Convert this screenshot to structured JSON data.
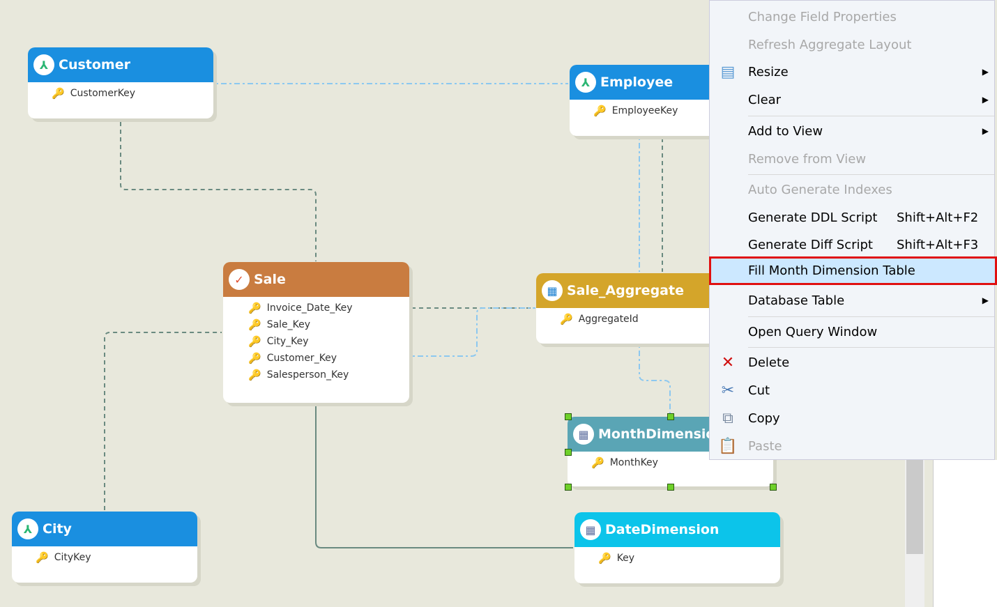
{
  "tables": {
    "customer": {
      "title": "Customer",
      "fields": [
        "CustomerKey"
      ],
      "color": "#1a8fe0"
    },
    "employee": {
      "title": "Employee",
      "fields": [
        "EmployeeKey"
      ],
      "color": "#1a8fe0"
    },
    "sale": {
      "title": "Sale",
      "fields": [
        "Invoice_Date_Key",
        "Sale_Key",
        "City_Key",
        "Customer_Key",
        "Salesperson_Key"
      ],
      "color": "#c97c40"
    },
    "sale_aggregate": {
      "title": "Sale_Aggregate",
      "fields": [
        "AggregateId"
      ],
      "color": "#d4a52a"
    },
    "month_dimension": {
      "title": "MonthDimension",
      "fields": [
        "MonthKey"
      ],
      "color": "#5aa5b5",
      "selected": true
    },
    "city": {
      "title": "City",
      "fields": [
        "CityKey"
      ],
      "color": "#1a8fe0"
    },
    "date_dimension": {
      "title": "DateDimension",
      "fields": [
        "Key"
      ],
      "color": "#0cc4ea"
    }
  },
  "menu": {
    "items": [
      {
        "label": "Change Field Properties",
        "disabled": true
      },
      {
        "label": "Refresh Aggregate Layout",
        "disabled": true
      },
      {
        "label": "Resize",
        "submenu": true,
        "icon": "resize-icon"
      },
      {
        "label": "Clear",
        "submenu": true
      },
      {
        "label": "Add to View",
        "submenu": true
      },
      {
        "label": "Remove from View",
        "disabled": true
      },
      {
        "label": "Auto Generate Indexes",
        "disabled": true
      },
      {
        "label": "Generate DDL Script",
        "shortcut": "Shift+Alt+F2"
      },
      {
        "label": "Generate Diff Script",
        "shortcut": "Shift+Alt+F3"
      },
      {
        "label": "Fill Month Dimension Table",
        "highlighted": true
      },
      {
        "label": "Database Table",
        "submenu": true
      },
      {
        "label": "Open Query Window"
      },
      {
        "label": "Delete",
        "icon": "delete-icon"
      },
      {
        "label": "Cut",
        "icon": "cut-icon"
      },
      {
        "label": "Copy",
        "icon": "copy-icon"
      },
      {
        "label": "Paste",
        "icon": "paste-icon",
        "disabled": true
      }
    ]
  }
}
